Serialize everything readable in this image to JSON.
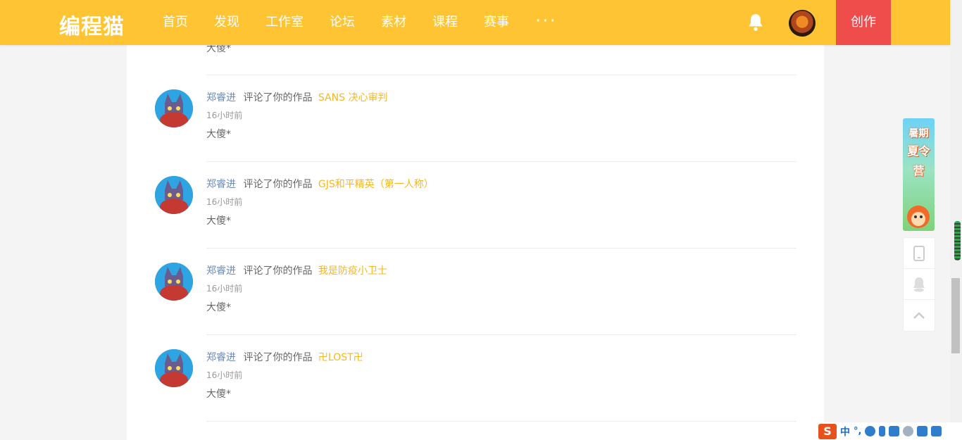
{
  "header": {
    "logo": "编程猫",
    "nav": [
      "首页",
      "发现",
      "工作室",
      "论坛",
      "素材",
      "课程",
      "赛事"
    ],
    "more": "···",
    "create_label": "创作",
    "icons": [
      "bell-icon",
      "user-avatar"
    ]
  },
  "colors": {
    "header_bg": "#fec433",
    "create_bg": "#ef4c4c",
    "link": "#f5b823",
    "username": "#6b8bb8"
  },
  "feed": {
    "previous_comment_tail": "大傻*",
    "notifications": [
      {
        "user": "郑睿进",
        "action": "评论了你的作品",
        "work": "SANS 决心审判",
        "time": "16小时前",
        "comment": "大傻*"
      },
      {
        "user": "郑睿进",
        "action": "评论了你的作品",
        "work": "GJS和平精英（第一人称）",
        "time": "16小时前",
        "comment": "大傻*"
      },
      {
        "user": "郑睿进",
        "action": "评论了你的作品",
        "work": "我是防疫小卫士",
        "time": "16小时前",
        "comment": "大傻*"
      },
      {
        "user": "郑睿进",
        "action": "评论了你的作品",
        "work": "卍LOST卍",
        "time": "16小时前",
        "comment": "大傻*"
      }
    ]
  },
  "side": {
    "banner_text": [
      "暑期",
      "夏令营"
    ],
    "tools": [
      "phone-icon",
      "qq-icon",
      "back-to-top-icon"
    ]
  },
  "ime": {
    "logo": "S",
    "lang": "中",
    "punct": "°,"
  }
}
